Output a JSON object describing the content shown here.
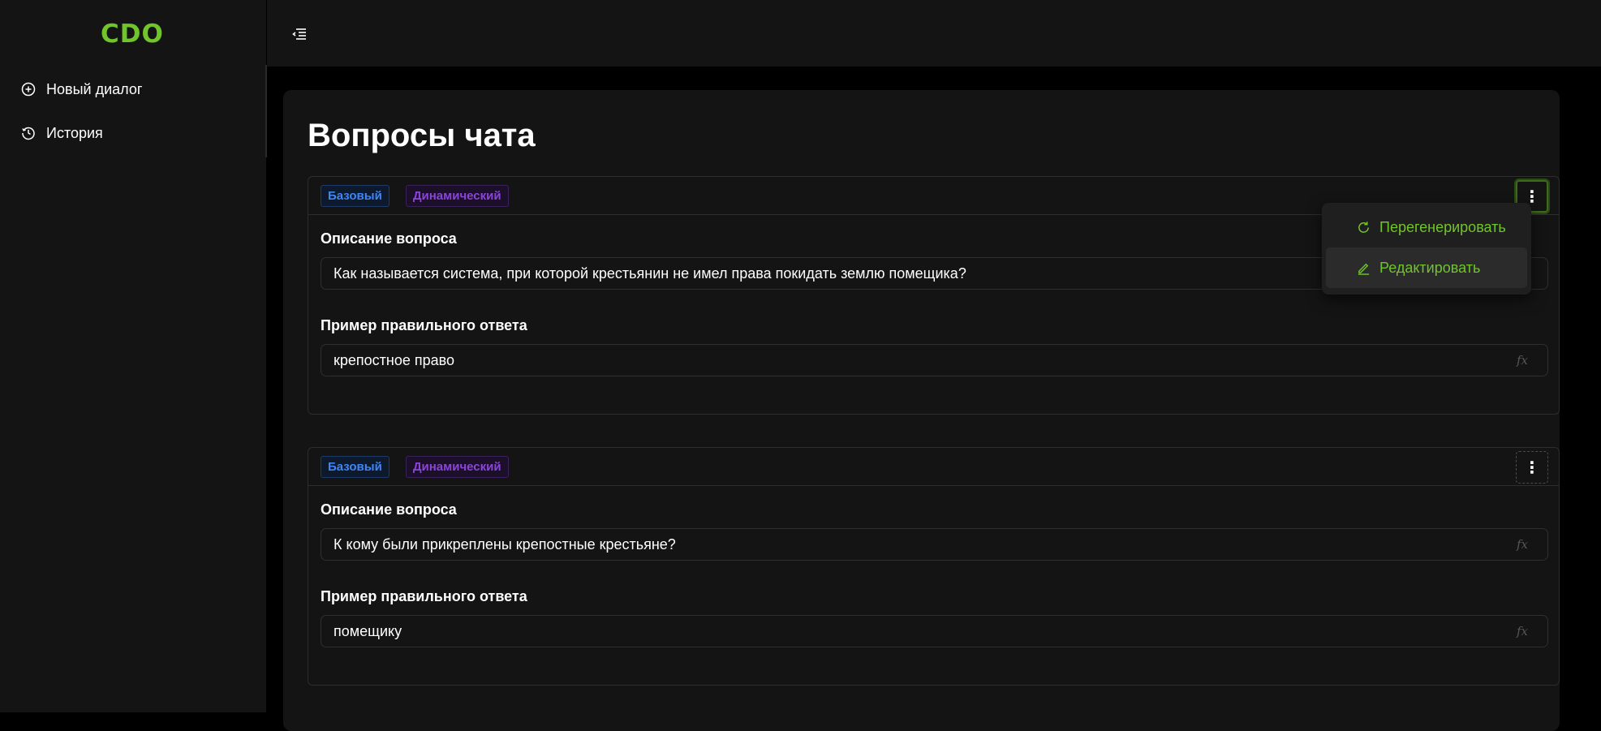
{
  "app": {
    "logo_text": "CDO"
  },
  "sidebar": {
    "items": [
      {
        "label": "Новый диалог",
        "icon": "plus-circle-icon"
      },
      {
        "label": "История",
        "icon": "history-icon"
      }
    ]
  },
  "main": {
    "title": "Вопросы чата",
    "cards": [
      {
        "tags": [
          "Базовый",
          "Динамический"
        ],
        "question_label": "Описание вопроса",
        "question_value": "Как называется система, при которой крестьянин не имел права покидать землю помещика?",
        "answer_label": "Пример правильного ответа",
        "answer_value": "крепостное право",
        "fx_label": "fx"
      },
      {
        "tags": [
          "Базовый",
          "Динамический"
        ],
        "question_label": "Описание вопроса",
        "question_value": "К кому были прикреплены крепостные крестьяне?",
        "answer_label": "Пример правильного ответа",
        "answer_value": "помещику",
        "fx_label": "fx"
      }
    ]
  },
  "dropdown": {
    "items": [
      {
        "label": "Перегенерировать",
        "icon": "refresh-icon"
      },
      {
        "label": "Редактировать",
        "icon": "pencil-icon"
      }
    ]
  },
  "colors": {
    "accent": "#6fc52a",
    "tag_basic": "#3f86f5",
    "tag_dynamic": "#8a45d8",
    "panel": "#141414",
    "background": "#000000"
  }
}
